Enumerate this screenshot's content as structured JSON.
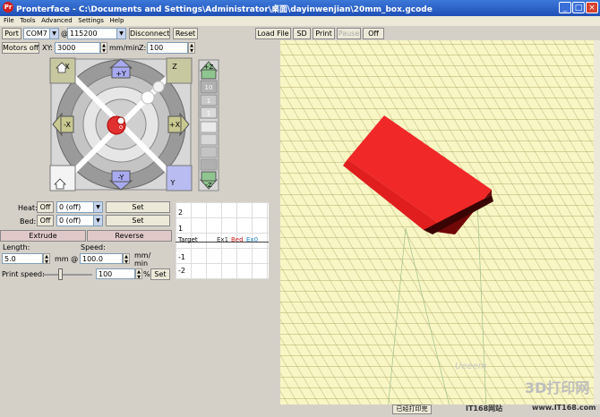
{
  "window": {
    "title": "Pronterface - C:\\Documents and Settings\\Administrator\\桌面\\dayinwenjian\\20mm_box.gcode",
    "icon_text": "Pr"
  },
  "menu": [
    "File",
    "Tools",
    "Advanced",
    "Settings",
    "Help"
  ],
  "connection": {
    "port_button": "Port",
    "port_value": "COM7",
    "at_label": "@",
    "baud_value": "115200",
    "disconnect": "Disconnect",
    "reset": "Reset"
  },
  "print_controls": {
    "load_file": "Load File",
    "sd": "SD",
    "print": "Print",
    "pause": "Pause",
    "off": "Off"
  },
  "motors": {
    "motors_off": "Motors off",
    "xy_label": "XY:",
    "xy_value": "3000",
    "unit": "mm/min",
    "z_label": "Z:",
    "z_value": "100"
  },
  "jog": {
    "plus_y": "+Y",
    "minus_y": "-Y",
    "plus_x": "+X",
    "minus_x": "-X",
    "home_x": "X",
    "home_y": "Y",
    "home_z": "Z",
    "plus_z": "+Z",
    "minus_z": "-Z",
    "center": "o",
    "z_steps": [
      "10",
      "1",
      "1"
    ]
  },
  "temperature": {
    "heat_label": "Heat:",
    "heat_off": "Off",
    "heat_value": "0 (off)",
    "heat_set": "Set",
    "bed_label": "Bed:",
    "bed_off": "Off",
    "bed_value": "0 (off)",
    "bed_set": "Set"
  },
  "extrude": {
    "extrude": "Extrude",
    "reverse": "Reverse",
    "length_label": "Length:",
    "length_value": "5.0",
    "mm_at": "mm @",
    "speed_label": "Speed:",
    "speed_value": "100.0",
    "speed_unit_top": "mm/",
    "speed_unit_bottom": "min"
  },
  "print_speed": {
    "label": "Print speed:",
    "value": "100",
    "percent": "%",
    "set": "Set",
    "slider_fraction": 0.35
  },
  "temp_graph": {
    "ticks": [
      "2",
      "1",
      "-1",
      "-2"
    ],
    "legend_target": "Target",
    "legend_ex1": "Ex1",
    "legend_bed": "Bed",
    "legend_ex0": "Ex0"
  },
  "status": {
    "task": "已经打印完"
  },
  "watermark": {
    "ueeem": "Ueeem",
    "print3d": "3D打印网",
    "site_left": "IT168网站",
    "site_right": "www.IT168.com"
  },
  "colors": {
    "accent_red": "#e02020",
    "grid_bg": "#f8f6c4"
  }
}
